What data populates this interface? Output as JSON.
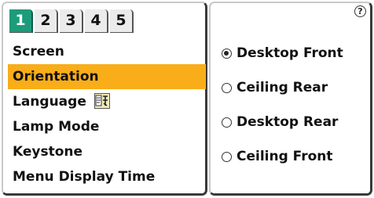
{
  "tabs": [
    "1",
    "2",
    "3",
    "4",
    "5"
  ],
  "active_tab": "1",
  "menu": {
    "items": [
      {
        "label": "Screen"
      },
      {
        "label": "Orientation",
        "selected": true
      },
      {
        "label": "Language",
        "icon": "language-icon"
      },
      {
        "label": "Lamp Mode"
      },
      {
        "label": "Keystone"
      },
      {
        "label": "Menu Display Time"
      }
    ]
  },
  "help_label": "?",
  "options": [
    {
      "label": "Desktop Front",
      "checked": true
    },
    {
      "label": "Ceiling Rear",
      "checked": false
    },
    {
      "label": "Desktop Rear",
      "checked": false
    },
    {
      "label": "Ceiling Front",
      "checked": false
    }
  ],
  "colors": {
    "active_tab": "#1c9c7a",
    "selection": "#f9ad19"
  }
}
